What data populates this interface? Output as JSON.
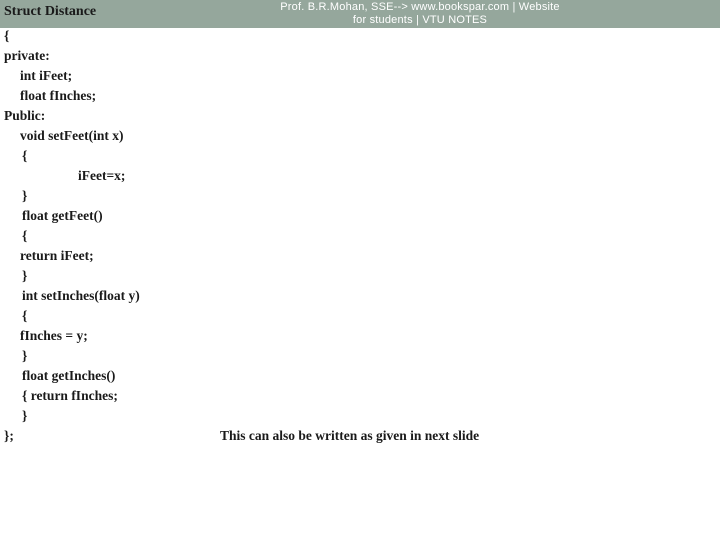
{
  "banner": {
    "background_color": "#95a79c",
    "watermark_text": "Prof. B.R.Mohan, SSE--> www.bookspar.com | Website\nfor students | VTU NOTES"
  },
  "slide": {
    "title": "Struct Distance",
    "text_color": "#1a1a1a",
    "background_color": "#ffffff"
  },
  "code": {
    "lines": [
      {
        "text": "{",
        "indent": "ind0"
      },
      {
        "text": "private:",
        "indent": "ind0"
      },
      {
        "text": "int iFeet;",
        "indent": "ind1"
      },
      {
        "text": "float fInches;",
        "indent": "ind1"
      },
      {
        "text": "Public:",
        "indent": "ind0"
      },
      {
        "text": "void setFeet(int x)",
        "indent": "ind1"
      },
      {
        "text": "{",
        "indent": "ind2"
      },
      {
        "text": "iFeet=x;",
        "indent": "ind3"
      },
      {
        "text": "}",
        "indent": "ind2"
      },
      {
        "text": "float getFeet()",
        "indent": "ind2"
      },
      {
        "text": "{",
        "indent": "ind2"
      },
      {
        "text": "return iFeet;",
        "indent": "ind1"
      },
      {
        "text": "}",
        "indent": "ind2"
      },
      {
        "text": "int setInches(float y)",
        "indent": "ind2"
      },
      {
        "text": "{",
        "indent": "ind2"
      },
      {
        "text": "fInches = y;",
        "indent": "ind1"
      },
      {
        "text": "}",
        "indent": "ind2"
      },
      {
        "text": "float getInches()",
        "indent": "ind2"
      },
      {
        "text": "{ return fInches;",
        "indent": "ind2"
      },
      {
        "text": "}",
        "indent": "ind2"
      },
      {
        "text": "};",
        "indent": "ind0"
      }
    ]
  },
  "footer": {
    "note": "This can also be written as given in next slide"
  }
}
